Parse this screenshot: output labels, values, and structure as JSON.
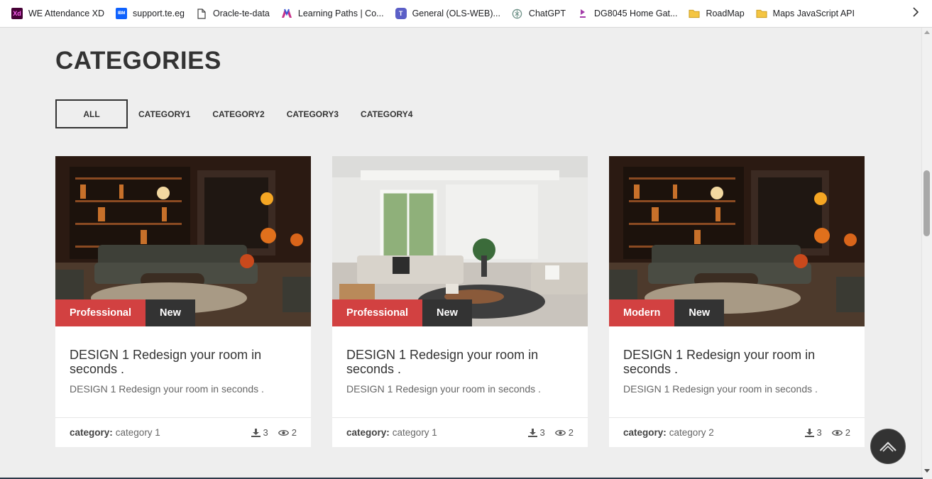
{
  "bookmarks": [
    {
      "label": "WE Attendance XD",
      "icon": "adobe-xd-icon",
      "glyph": "Xd"
    },
    {
      "label": "support.te.eg",
      "icon": "ibm-icon",
      "glyph": "IBM"
    },
    {
      "label": "Oracle-te-data",
      "icon": "document-icon",
      "glyph": ""
    },
    {
      "label": "Learning Paths | Co...",
      "icon": "learning-paths-icon",
      "glyph": ""
    },
    {
      "label": "General (OLS-WEB)...",
      "icon": "teams-icon",
      "glyph": "T"
    },
    {
      "label": "ChatGPT",
      "icon": "chatgpt-icon",
      "glyph": ""
    },
    {
      "label": "DG8045 Home Gat...",
      "icon": "router-icon",
      "glyph": ""
    },
    {
      "label": "RoadMap",
      "icon": "folder-icon",
      "glyph": ""
    },
    {
      "label": "Maps JavaScript API",
      "icon": "folder-icon",
      "glyph": ""
    }
  ],
  "page": {
    "title": "CATEGORIES"
  },
  "filters": [
    {
      "label": "ALL",
      "active": true
    },
    {
      "label": "CATEGORY1",
      "active": false
    },
    {
      "label": "CATEGORY2",
      "active": false
    },
    {
      "label": "CATEGORY3",
      "active": false
    },
    {
      "label": "CATEGORY4",
      "active": false
    }
  ],
  "cards": [
    {
      "image": "halloween-living-room",
      "tag_primary": "Professional",
      "tag_secondary": "New",
      "title": "DESIGN 1 Redesign your room in seconds .",
      "description": "DESIGN 1 Redesign your room in seconds .",
      "category_label": "category:",
      "category_value": "category 1",
      "downloads": "3",
      "views": "2"
    },
    {
      "image": "white-modern-living-room",
      "tag_primary": "Professional",
      "tag_secondary": "New",
      "title": "DESIGN 1 Redesign your room in seconds .",
      "description": "DESIGN 1 Redesign your room in seconds .",
      "category_label": "category:",
      "category_value": "category 1",
      "downloads": "3",
      "views": "2"
    },
    {
      "image": "halloween-living-room",
      "tag_primary": "Modern",
      "tag_secondary": "New",
      "title": "DESIGN 1 Redesign your room in seconds .",
      "description": "DESIGN 1 Redesign your room in seconds .",
      "category_label": "category:",
      "category_value": "category 2",
      "downloads": "3",
      "views": "2"
    }
  ],
  "colors": {
    "accent_red": "#d24141",
    "dark": "#333333",
    "page_bg": "#eeeeee"
  }
}
